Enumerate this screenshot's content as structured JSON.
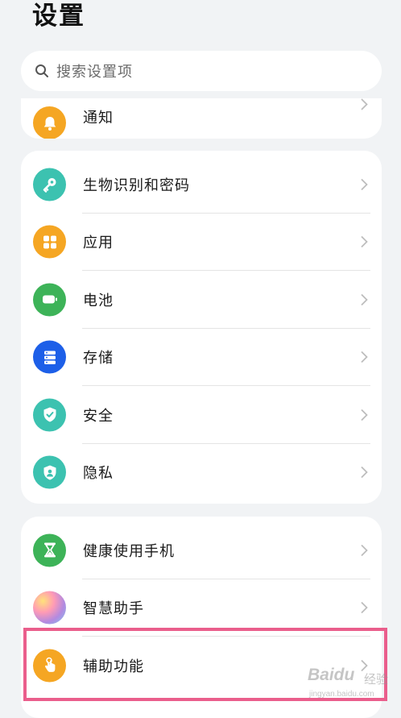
{
  "header": {
    "title": "设置"
  },
  "search": {
    "placeholder": "搜索设置项"
  },
  "groups": [
    {
      "items": [
        {
          "label": "通知",
          "icon": "bell-icon",
          "color": "#f5a623"
        }
      ]
    },
    {
      "items": [
        {
          "label": "生物识别和密码",
          "icon": "key-icon",
          "color": "#3cc2b0"
        },
        {
          "label": "应用",
          "icon": "apps-grid-icon",
          "color": "#f5a623"
        },
        {
          "label": "电池",
          "icon": "battery-icon",
          "color": "#3db358"
        },
        {
          "label": "存储",
          "icon": "storage-icon",
          "color": "#1d5fe8"
        },
        {
          "label": "安全",
          "icon": "shield-check-icon",
          "color": "#3cc2b0"
        },
        {
          "label": "隐私",
          "icon": "privacy-shield-icon",
          "color": "#3cc2b0"
        }
      ]
    },
    {
      "items": [
        {
          "label": "健康使用手机",
          "icon": "hourglass-icon",
          "color": "#3db358"
        },
        {
          "label": "智慧助手",
          "icon": "assistant-orb-icon",
          "color": "#b38ae0"
        },
        {
          "label": "辅助功能",
          "icon": "accessibility-hand-icon",
          "color": "#f5a623"
        }
      ]
    }
  ],
  "watermark": {
    "brand": "Baidu",
    "product": "经验",
    "url": "jingyan.baidu.com"
  }
}
